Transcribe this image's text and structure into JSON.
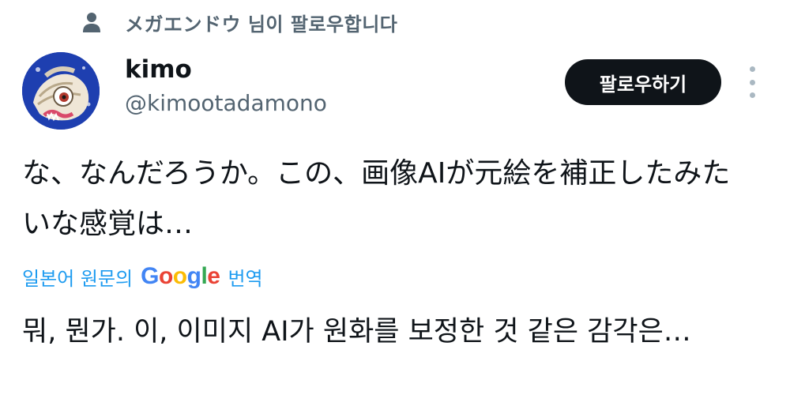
{
  "context": {
    "icon": "person-icon",
    "text": "メガエンドウ 님이 팔로우합니다"
  },
  "user": {
    "display_name": "kimo",
    "handle": "@kimootadamono",
    "avatar_icon": "avatar-illustration"
  },
  "actions": {
    "follow_label": "팔로우하기",
    "more_icon": "more-vertical-icon"
  },
  "tweet": {
    "text": "な、なんだろうか。この、画像AIが元絵を補正したみたいな感覚は…"
  },
  "translation": {
    "label_prefix": "일본어 원문의",
    "google_logo": "Google",
    "label_suffix": "번역",
    "translated_text": "뭐, 뭔가. 이, 이미지 AI가 원화를 보정한 것 같은 감각은…"
  },
  "colors": {
    "text_primary": "#0f1419",
    "text_secondary": "#536471",
    "link_blue": "#1d9bf0",
    "button_bg": "#0f1419",
    "google_blue": "#4285F4",
    "google_red": "#EA4335",
    "google_yellow": "#FBBC05",
    "google_green": "#34A853"
  }
}
